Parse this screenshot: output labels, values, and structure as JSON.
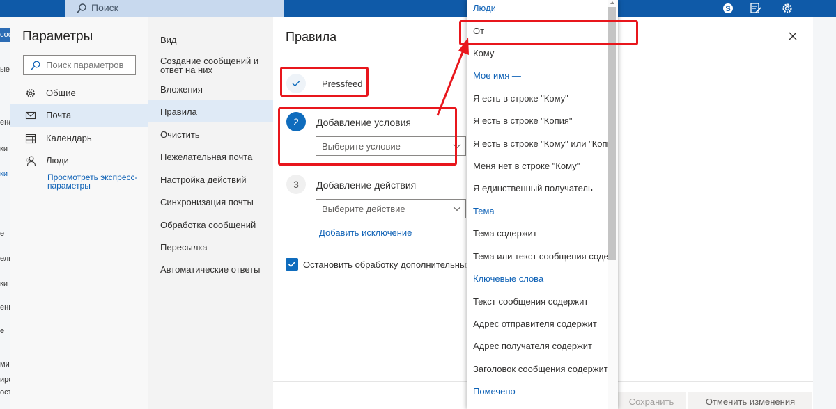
{
  "topbar": {
    "search_placeholder": "Поиск",
    "icons": [
      "skype-icon",
      "edit-notes-icon",
      "gear-icon"
    ]
  },
  "background_fragments": [
    "сооб",
    "ые",
    "ена",
    "ки",
    "ки в",
    "е",
    "ель",
    "ки",
    "ения",
    "е",
    "ми",
    "ирс",
    "ост"
  ],
  "settings": {
    "title": "Параметры",
    "search_placeholder": "Поиск параметров",
    "nav": [
      {
        "label": "Общие",
        "icon": "gear-icon"
      },
      {
        "label": "Почта",
        "icon": "mail-icon",
        "selected": true
      },
      {
        "label": "Календарь",
        "icon": "calendar-icon"
      },
      {
        "label": "Люди",
        "icon": "people-icon"
      }
    ],
    "quick_settings_link": "Просмотреть экспресс-параметры"
  },
  "mail_menu": {
    "items": [
      {
        "label": "Вид"
      },
      {
        "label": "Создание сообщений и ответ на них"
      },
      {
        "label": "Вложения"
      },
      {
        "label": "Правила",
        "selected": true
      },
      {
        "label": "Очистить"
      },
      {
        "label": "Нежелательная почта"
      },
      {
        "label": "Настройка действий"
      },
      {
        "label": "Синхронизация почты"
      },
      {
        "label": "Обработка сообщений"
      },
      {
        "label": "Пересылка"
      },
      {
        "label": "Автоматические ответы"
      }
    ]
  },
  "rules": {
    "title": "Правила",
    "name_value": "Pressfeed",
    "step2_number": "2",
    "step2_title": "Добавление условия",
    "condition_placeholder": "Выберите условие",
    "step3_number": "3",
    "step3_title": "Добавление действия",
    "action_placeholder": "Выберите действие",
    "add_exception": "Добавить исключение",
    "stop_processing_label": "Остановить обработку дополнительных",
    "stop_processing_checked": true,
    "save_button": "Сохранить",
    "discard_button": "Отменить изменения"
  },
  "condition_dropdown": {
    "rows": [
      {
        "label": "Люди",
        "header": true
      },
      {
        "label": "От",
        "highlighted": true
      },
      {
        "label": "Кому"
      },
      {
        "label": "Мое имя —",
        "header": true
      },
      {
        "label": "Я есть в строке \"Кому\""
      },
      {
        "label": "Я есть в строке \"Копия\""
      },
      {
        "label": "Я есть в строке \"Кому\" или \"Копия\""
      },
      {
        "label": "Меня нет в строке \"Кому\""
      },
      {
        "label": "Я единственный получатель"
      },
      {
        "label": "Тема",
        "header": true
      },
      {
        "label": "Тема содержит"
      },
      {
        "label": "Тема или текст сообщения содержит"
      },
      {
        "label": "Ключевые слова",
        "header": true
      },
      {
        "label": "Текст сообщения содержит"
      },
      {
        "label": "Адрес отправителя содержит"
      },
      {
        "label": "Адрес получателя содержит"
      },
      {
        "label": "Заголовок сообщения содержит"
      },
      {
        "label": "Помечено",
        "header": true
      }
    ]
  },
  "colors": {
    "brand": "#0f5aa8",
    "accent": "#0f6cbd",
    "link": "#0f62b6",
    "annotation": "#e8161c"
  }
}
